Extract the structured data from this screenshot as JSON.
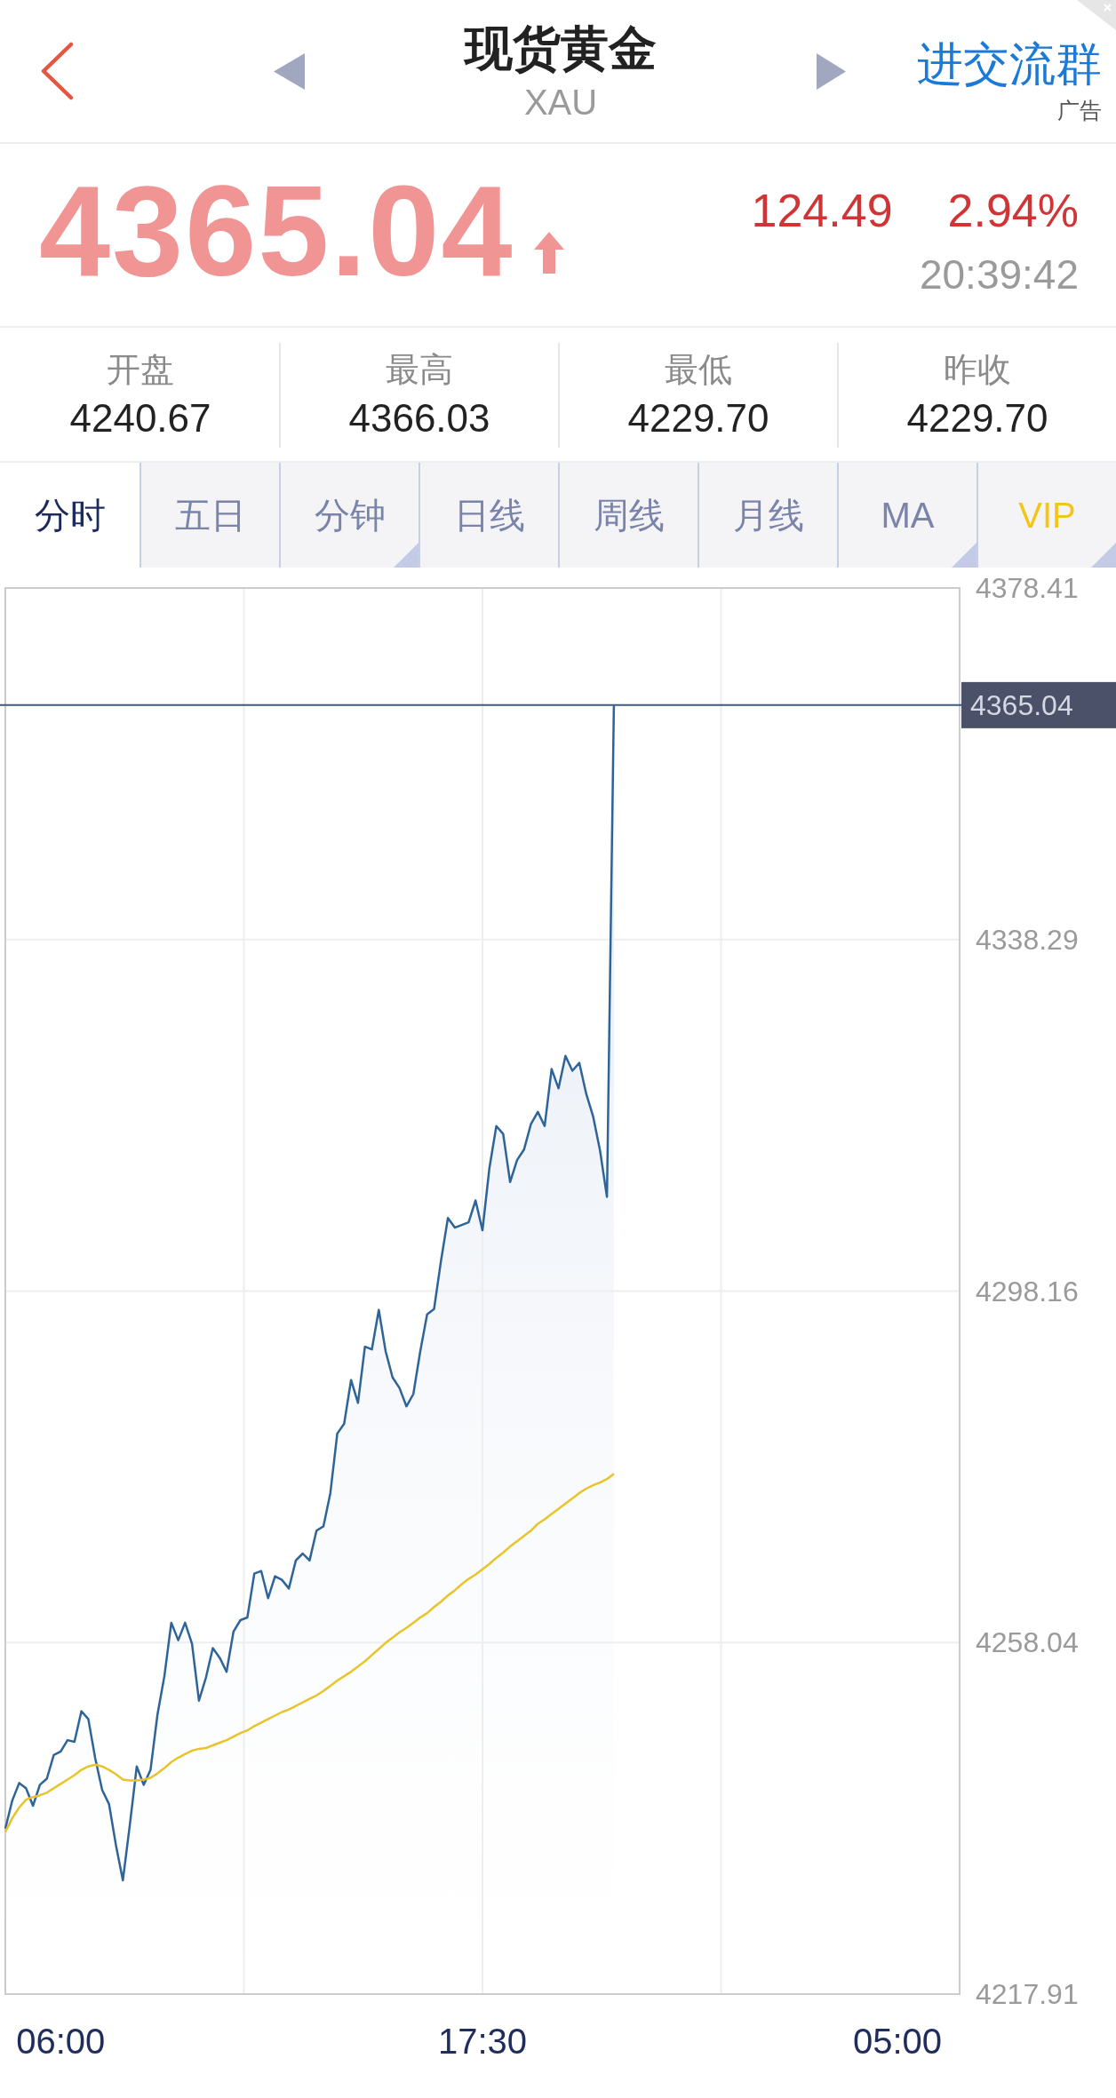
{
  "header": {
    "title": "现货黄金",
    "symbol": "XAU",
    "action": "进交流群",
    "ad_label": "广告"
  },
  "quote": {
    "price": "4365.04",
    "rising": true,
    "change": "124.49",
    "change_percent": "2.94%",
    "time": "20:39:42"
  },
  "stats": [
    {
      "label": "开盘",
      "value": "4240.67"
    },
    {
      "label": "最高",
      "value": "4366.03"
    },
    {
      "label": "最低",
      "value": "4229.70"
    },
    {
      "label": "昨收",
      "value": "4229.70"
    }
  ],
  "tabs": [
    {
      "label": "分时",
      "selected": true,
      "dropdown": false,
      "kind": "standard"
    },
    {
      "label": "五日",
      "selected": false,
      "dropdown": false,
      "kind": "standard"
    },
    {
      "label": "分钟",
      "selected": false,
      "dropdown": true,
      "kind": "standard"
    },
    {
      "label": "日线",
      "selected": false,
      "dropdown": false,
      "kind": "standard"
    },
    {
      "label": "周线",
      "selected": false,
      "dropdown": false,
      "kind": "standard"
    },
    {
      "label": "月线",
      "selected": false,
      "dropdown": false,
      "kind": "standard"
    },
    {
      "label": "MA",
      "selected": false,
      "dropdown": true,
      "kind": "standard"
    },
    {
      "label": "VIP",
      "selected": false,
      "dropdown": true,
      "kind": "premium"
    }
  ],
  "chart": {
    "chart_data": {
      "type": "area",
      "grid": true,
      "categories": [
        null,
        null,
        null,
        null,
        null,
        null,
        null,
        null,
        "06:00",
        null,
        null,
        null,
        null,
        null,
        null,
        null,
        null,
        null,
        null,
        null,
        null,
        null,
        null,
        null,
        null,
        null,
        null,
        null,
        null,
        null,
        null,
        null,
        null,
        null,
        null,
        null,
        null,
        null,
        null,
        null,
        null,
        null,
        null,
        null,
        null,
        null,
        null,
        null,
        null,
        null,
        null,
        null,
        null,
        null,
        null,
        null,
        null,
        null,
        null,
        null,
        null,
        null,
        null,
        null,
        null,
        null,
        null,
        null,
        null,
        "17:30",
        null,
        null,
        null,
        null,
        null,
        null,
        null,
        null,
        null,
        null,
        null,
        null,
        null,
        null,
        null,
        null,
        null,
        null,
        null,
        null,
        null,
        null,
        null,
        null,
        null,
        null,
        null,
        null,
        null,
        null,
        null,
        null,
        null,
        null,
        null,
        null,
        null,
        null,
        null,
        null,
        null,
        null,
        null,
        null,
        null,
        null,
        null,
        null,
        null,
        null,
        null,
        null,
        null,
        null,
        null,
        null,
        null,
        null,
        null,
        "05:00",
        null,
        null,
        null,
        null,
        null,
        null,
        null,
        null,
        null
      ],
      "series": [
        {
          "color": "#2f6499",
          "values": [
            4236.8,
            4240.0,
            4242.0,
            4241.4,
            4239.4,
            4241.8,
            4242.5,
            4245.2,
            4245.6,
            4246.9,
            4246.7,
            4250.2,
            4249.3,
            4244.8,
            4241.2,
            4239.6,
            4234.9,
            4230.9,
            4237.2,
            4243.9,
            4241.8,
            4243.5,
            4249.8,
            4254.2,
            4260.3,
            4258.3,
            4260.3,
            4257.9,
            4251.4,
            4254.0,
            4257.4,
            4256.3,
            4254.7,
            4259.3,
            4260.6,
            4260.9,
            4265.9,
            4266.2,
            4263.1,
            4265.6,
            4265.2,
            4264.2,
            4267.4,
            4268.2,
            4267.4,
            4270.8,
            4271.3,
            4275.1,
            4281.9,
            4283.0,
            4288.0,
            4285.4,
            4291.8,
            4291.5,
            4296.0,
            4291.3,
            4288.3,
            4287.1,
            4285.0,
            4286.4,
            4291.3,
            4295.5,
            4296.1,
            4301.6,
            4306.5,
            4305.4,
            4305.7,
            4306.0,
            4308.5,
            4305.1,
            4312.2,
            4317.0,
            4316.1,
            4310.6,
            4313.1,
            4314.3,
            4317.2,
            4318.6,
            4317.0,
            4323.5,
            4321.3,
            4325.0,
            4323.3,
            4324.2,
            4320.7,
            4318.1,
            4314.2,
            4308.9,
            4365.0,
            null,
            null,
            null,
            null,
            null,
            null,
            null,
            null,
            null,
            null,
            null,
            null,
            null,
            null,
            null,
            null,
            null,
            null,
            null,
            null,
            null,
            null,
            null,
            null,
            null,
            null,
            null,
            null,
            null,
            null,
            null,
            null,
            null,
            null,
            null,
            null,
            null,
            null,
            null,
            null,
            null,
            null,
            null,
            null,
            null,
            null,
            null,
            null,
            null,
            null
          ]
        },
        {
          "type": "line",
          "color": "#e8c42a",
          "values": [
            4236.4,
            4238.0,
            4239.2,
            4240.1,
            4240.4,
            4240.6,
            4240.9,
            4241.4,
            4241.9,
            4242.4,
            4242.9,
            4243.5,
            4243.9,
            4244.1,
            4243.9,
            4243.5,
            4243.0,
            4242.4,
            4242.3,
            4242.3,
            4242.4,
            4242.6,
            4243.1,
            4243.7,
            4244.4,
            4244.9,
            4245.3,
            4245.7,
            4245.9,
            4246.0,
            4246.3,
            4246.6,
            4246.9,
            4247.3,
            4247.7,
            4248.0,
            4248.5,
            4248.9,
            4249.3,
            4249.7,
            4250.1,
            4250.4,
            4250.8,
            4251.2,
            4251.6,
            4252.0,
            4252.5,
            4253.1,
            4253.7,
            4254.2,
            4254.7,
            4255.3,
            4255.9,
            4256.6,
            4257.3,
            4258.0,
            4258.6,
            4259.2,
            4259.7,
            4260.3,
            4260.9,
            4261.4,
            4262.1,
            4262.7,
            4263.4,
            4264.0,
            4264.7,
            4265.3,
            4265.8,
            4266.4,
            4267.0,
            4267.7,
            4268.3,
            4269.0,
            4269.6,
            4270.2,
            4270.8,
            4271.6,
            4272.1,
            4272.7,
            4273.3,
            4273.9,
            4274.5,
            4275.1,
            4275.6,
            4276.0,
            4276.3,
            4276.7,
            4277.3,
            null,
            null,
            null,
            null,
            null,
            null,
            null,
            null,
            null,
            null,
            null,
            null,
            null,
            null,
            null,
            null,
            null,
            null,
            null,
            null,
            null,
            null,
            null,
            null,
            null,
            null,
            null,
            null,
            null,
            null,
            null,
            null,
            null,
            null,
            null,
            null,
            null,
            null,
            null,
            null,
            null,
            null,
            null,
            null,
            null,
            null,
            null,
            null,
            null,
            null
          ]
        }
      ],
      "ylim": [
        4217.91,
        4378.41
      ],
      "yticks": [
        4378.41,
        4338.29,
        4298.16,
        4258.04,
        4217.91
      ],
      "ref_lines": [
        {
          "axis": "y",
          "value": 4365.04,
          "label": "4365.04"
        }
      ]
    }
  }
}
